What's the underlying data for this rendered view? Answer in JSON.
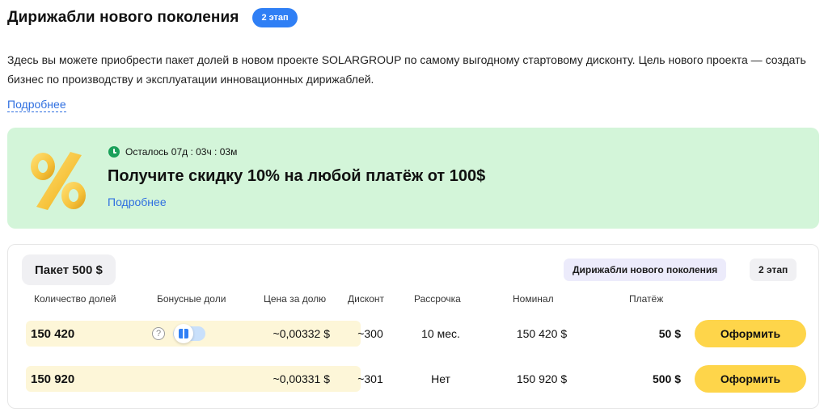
{
  "header": {
    "title": "Дирижабли нового поколения",
    "stage_badge": "2 этап"
  },
  "description": "Здесь вы можете приобрести пакет долей в новом проекте SOLARGROUP по самому выгодному стартовому дисконту. Цель нового проекта — создать бизнес по производству и эксплуатации инновационных дирижаблей.",
  "more_link": "Подробнее",
  "promo": {
    "timer": "Осталось 07д : 03ч : 03м",
    "title": "Получите скидку 10% на любой платёж от 100$",
    "link": "Подробнее",
    "bg_color": "#d3f5d9"
  },
  "package": {
    "title": "Пакет 500 $",
    "project_tag": "Дирижабли нового поколения",
    "stage_tag": "2 этап",
    "columns": [
      "Количество долей",
      "Бонусные доли",
      "Цена за долю",
      "Дисконт",
      "Рассрочка",
      "Номинал",
      "Платёж"
    ],
    "rows": [
      {
        "quantity": "150 420",
        "bonus_help": "?",
        "price": "~0,00332 $",
        "discount": "~300",
        "installment": "10 мес.",
        "nominal": "150 420 $",
        "payment": "50 $",
        "button": "Оформить"
      },
      {
        "quantity": "150 920",
        "price": "~0,00331 $",
        "discount": "~301",
        "installment": "Нет",
        "nominal": "150 920 $",
        "payment": "500 $",
        "button": "Оформить"
      }
    ]
  },
  "colors": {
    "accent_blue": "#2f7ff5",
    "button_yellow": "#fed54a",
    "row_highlight": "#fdf6d8"
  }
}
